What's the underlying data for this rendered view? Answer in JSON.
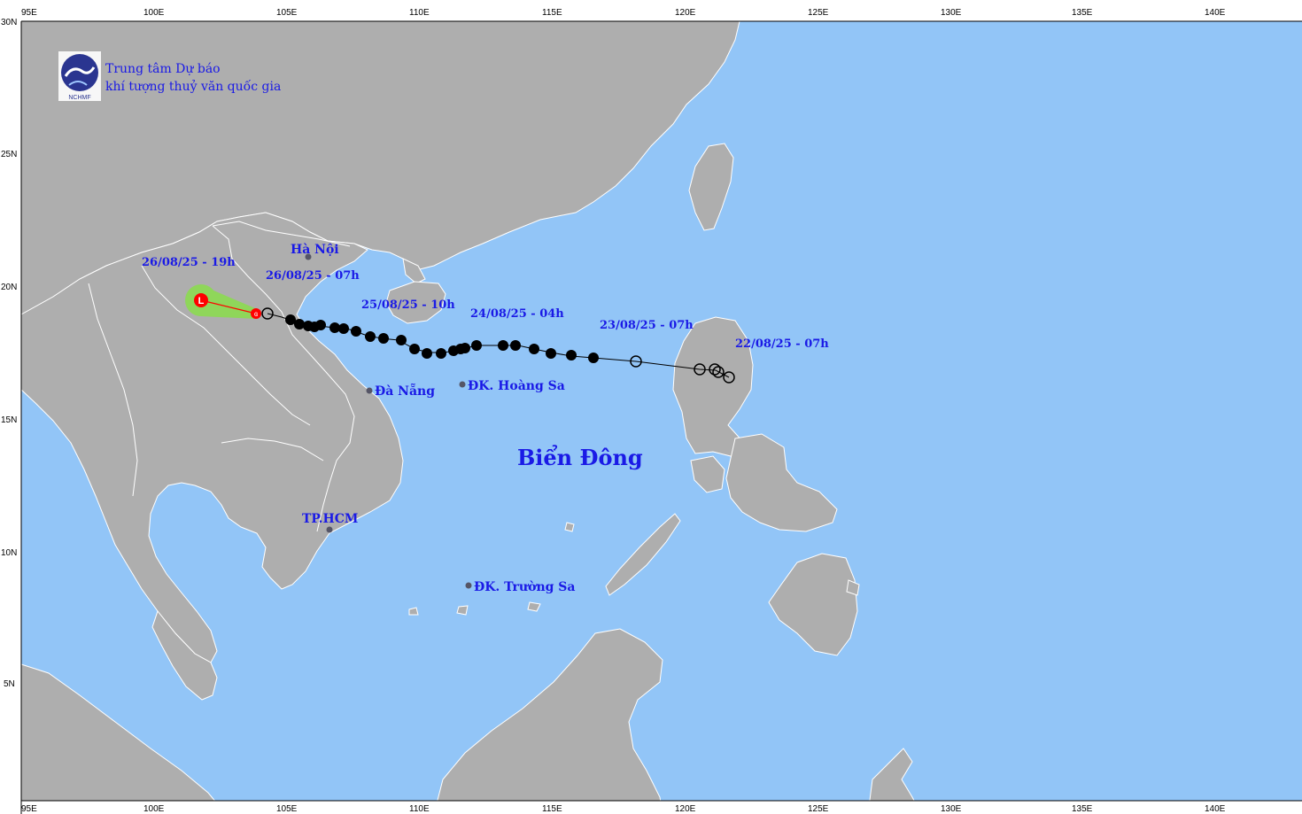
{
  "header": {
    "logo_text": "NCHMF",
    "org_line1": "Trung tâm Dự báo",
    "org_line2": "khí tượng thuỷ văn quốc gia"
  },
  "axes": {
    "top_lon": [
      "95E",
      "100E",
      "105E",
      "110E",
      "115E",
      "120E",
      "125E",
      "130E",
      "135E",
      "140E"
    ],
    "bottom_lon": [
      "95E",
      "100E",
      "105E",
      "110E",
      "115E",
      "120E",
      "125E",
      "130E",
      "135E",
      "140E"
    ],
    "left_lat": [
      "30N",
      "25N",
      "20N",
      "15N",
      "10N",
      "5N"
    ]
  },
  "places": {
    "hanoi": "Hà Nội",
    "danang": "Đà Nẵng",
    "hoangsa": "ĐK. Hoàng Sa",
    "hcm": "TP.HCM",
    "truongsa": "ĐK. Trường Sa",
    "sea": "Biển Đông"
  },
  "track_times": {
    "t1": "26/08/25 - 19h",
    "t2": "26/08/25 - 07h",
    "t3": "25/08/25 - 10h",
    "t4": "24/08/25 - 04h",
    "t5": "23/08/25 - 07h",
    "t6": "22/08/25 - 07h"
  },
  "forecast_symbol": "L",
  "colors": {
    "sea": "#92c5f7",
    "land": "#aeaeae",
    "label": "#1a1ae6",
    "track": "#000000",
    "forecast_cone": "#8fd65a",
    "forecast_point": "#ff0000"
  }
}
